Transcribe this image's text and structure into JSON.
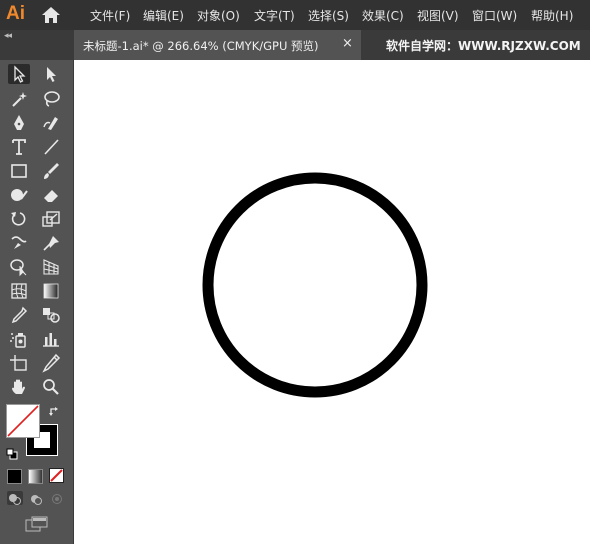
{
  "app": {
    "logo_text": "Ai"
  },
  "menu": {
    "items": [
      {
        "label": "文件(F)"
      },
      {
        "label": "编辑(E)"
      },
      {
        "label": "对象(O)"
      },
      {
        "label": "文字(T)"
      },
      {
        "label": "选择(S)"
      },
      {
        "label": "效果(C)"
      },
      {
        "label": "视图(V)"
      },
      {
        "label": "窗口(W)"
      },
      {
        "label": "帮助(H)"
      }
    ]
  },
  "tab": {
    "title": "未标题-1.ai* @ 266.64% (CMYK/GPU 预览)",
    "close_glyph": "×"
  },
  "watermark": "软件自学网：WWW.RJZXW.COM",
  "panel_collapse_glyph": "◂◂",
  "colors": {
    "accent_logo": "#f0882c",
    "menubar_bg": "#323232",
    "toolbar_bg": "#535353",
    "canvas_bg": "#ffffff",
    "stroke": "#000000"
  },
  "tools": [
    "selection-tool-icon",
    "direct-selection-tool-icon",
    "magic-wand-icon",
    "lasso-icon",
    "pen-tool-icon",
    "curvature-tool-icon",
    "type-tool-icon",
    "line-segment-tool-icon",
    "rectangle-tool-icon",
    "paintbrush-tool-icon",
    "shaper-tool-icon",
    "eraser-tool-icon",
    "rotate-tool-icon",
    "scale-tool-icon",
    "warp-tool-icon",
    "puppet-warp-icon",
    "shape-builder-icon",
    "perspective-grid-icon",
    "mesh-tool-icon",
    "gradient-tool-icon",
    "eyedropper-icon",
    "blend-tool-icon",
    "symbol-sprayer-icon",
    "column-graph-icon",
    "artboard-tool-icon",
    "slice-tool-icon",
    "hand-tool-icon",
    "zoom-tool-icon"
  ]
}
